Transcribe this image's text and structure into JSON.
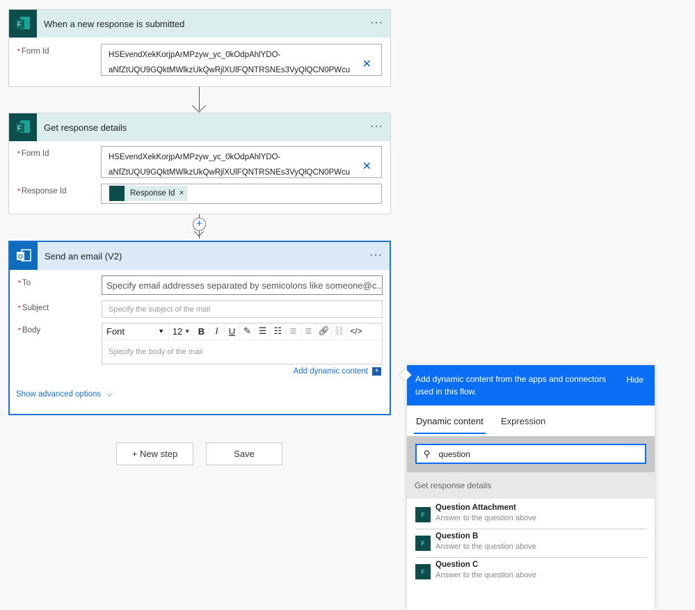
{
  "trigger": {
    "title": "When a new response is submitted",
    "more": "···",
    "form_id_label": "Form Id",
    "form_id_line1": "HSEvendXekKorjpArMPzyw_yc_0kOdpAhlYDO-",
    "form_id_line2": "aNfZtUQU9GQktMWlkzUkQwRjlXUlFQNTRSNEs3VyQlQCN0PWcu",
    "icon": "microsoft-forms-icon"
  },
  "details": {
    "title": "Get response details",
    "more": "···",
    "form_id_label": "Form Id",
    "form_id_line1": "HSEvendXekKorjpArMPzyw_yc_0kOdpAhlYDO-",
    "form_id_line2": "aNfZtUQU9GQktMWlkzUkQwRjlXUlFQNTRSNEs3VyQlQCN0PWcu",
    "response_id_label": "Response Id",
    "response_token": "Response Id",
    "token_remove": "×"
  },
  "email": {
    "title": "Send an email (V2)",
    "more": "···",
    "icon": "outlook-icon",
    "to_label": "To",
    "to_placeholder": "Specify email addresses separated by semicolons like someone@c...",
    "subject_label": "Subject",
    "subject_placeholder": "Specify the subject of the mail",
    "body_label": "Body",
    "font": "Font",
    "font_size": "12",
    "body_placeholder": "Specify the body of the mail",
    "add_dynamic": "Add dynamic content",
    "show_advanced": "Show advanced options"
  },
  "actions": {
    "new_step": "+ New step",
    "save": "Save"
  },
  "panel": {
    "header": "Add dynamic content from the apps and connectors used in this flow.",
    "hide": "Hide",
    "tabs": [
      "Dynamic content",
      "Expression"
    ],
    "search_value": "question",
    "section": "Get response details",
    "items": [
      {
        "name": "Question Attachment",
        "desc": "Answer to the question above"
      },
      {
        "name": "Question B",
        "desc": "Answer to the question above"
      },
      {
        "name": "Question C",
        "desc": "Answer to the question above"
      }
    ]
  },
  "colors": {
    "accent": "#0a6ef5",
    "forms": "#0d4d4b",
    "outlook": "#0f6cbd"
  }
}
